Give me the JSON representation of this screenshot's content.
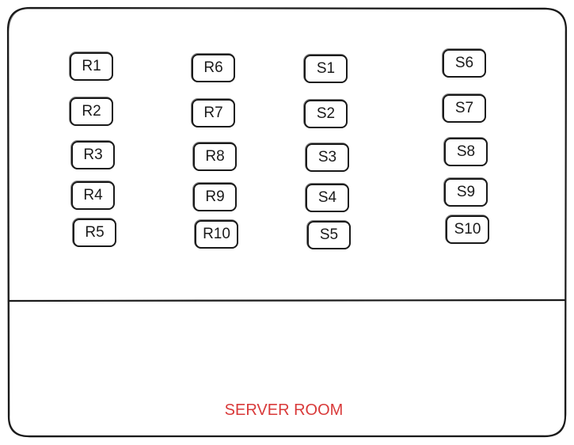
{
  "title": "SERVER ROOM",
  "title_color": "#d93a3a",
  "columns": [
    [
      "R1",
      "R2",
      "R3",
      "R4",
      "R5"
    ],
    [
      "R6",
      "R7",
      "R8",
      "R9",
      "R10"
    ],
    [
      "S1",
      "S2",
      "S3",
      "S4",
      "S5"
    ],
    [
      "S6",
      "S7",
      "S8",
      "S9",
      "S10"
    ]
  ]
}
